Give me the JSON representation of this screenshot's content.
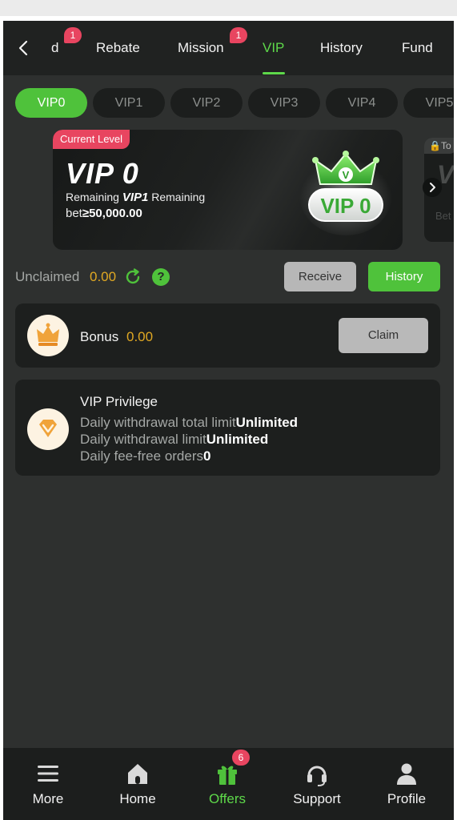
{
  "topnav": {
    "tabs": [
      {
        "label": "d",
        "badge": "1"
      },
      {
        "label": "Rebate"
      },
      {
        "label": "Mission",
        "badge": "1"
      },
      {
        "label": "VIP",
        "active": true
      },
      {
        "label": "History"
      },
      {
        "label": "Fund"
      }
    ]
  },
  "levels": [
    "VIP0",
    "VIP1",
    "VIP2",
    "VIP3",
    "VIP4",
    "VIP5"
  ],
  "card": {
    "tag": "Current Level",
    "title": "VIP 0",
    "remaining_prefix": "Remaining ",
    "next_level": "VIP1",
    "remaining_suffix": " Remaining",
    "bet_label": "bet",
    "bet_amount": "≥50,000.00",
    "emblem_text": "VIP 0",
    "emblem_letter": "V",
    "next_card_tag": "To",
    "next_card_vip": "V",
    "next_card_bet": "Bet"
  },
  "unclaimed": {
    "label": "Unclaimed",
    "value": "0.00",
    "help": "?",
    "receive_label": "Receive",
    "history_label": "History"
  },
  "bonus": {
    "label": "Bonus",
    "value": "0.00",
    "claim_label": "Claim"
  },
  "privilege": {
    "title": "VIP Privilege",
    "items": [
      {
        "label": "Daily withdrawal total limit",
        "value": "Unlimited"
      },
      {
        "label": "Daily withdrawal limit",
        "value": "Unlimited"
      },
      {
        "label": "Daily fee-free orders",
        "value": "0"
      }
    ]
  },
  "bottomnav": {
    "items": [
      {
        "label": "More",
        "icon": "menu-icon"
      },
      {
        "label": "Home",
        "icon": "home-icon"
      },
      {
        "label": "Offers",
        "icon": "gift-icon",
        "badge": "6",
        "active": true
      },
      {
        "label": "Support",
        "icon": "headset-icon"
      },
      {
        "label": "Profile",
        "icon": "user-icon"
      }
    ]
  },
  "colors": {
    "accent_green": "#4fc23b",
    "badge_red": "#e84560",
    "amount_gold": "#e0a823",
    "panel_dark": "#1d1f1e",
    "background": "#2e302f"
  }
}
